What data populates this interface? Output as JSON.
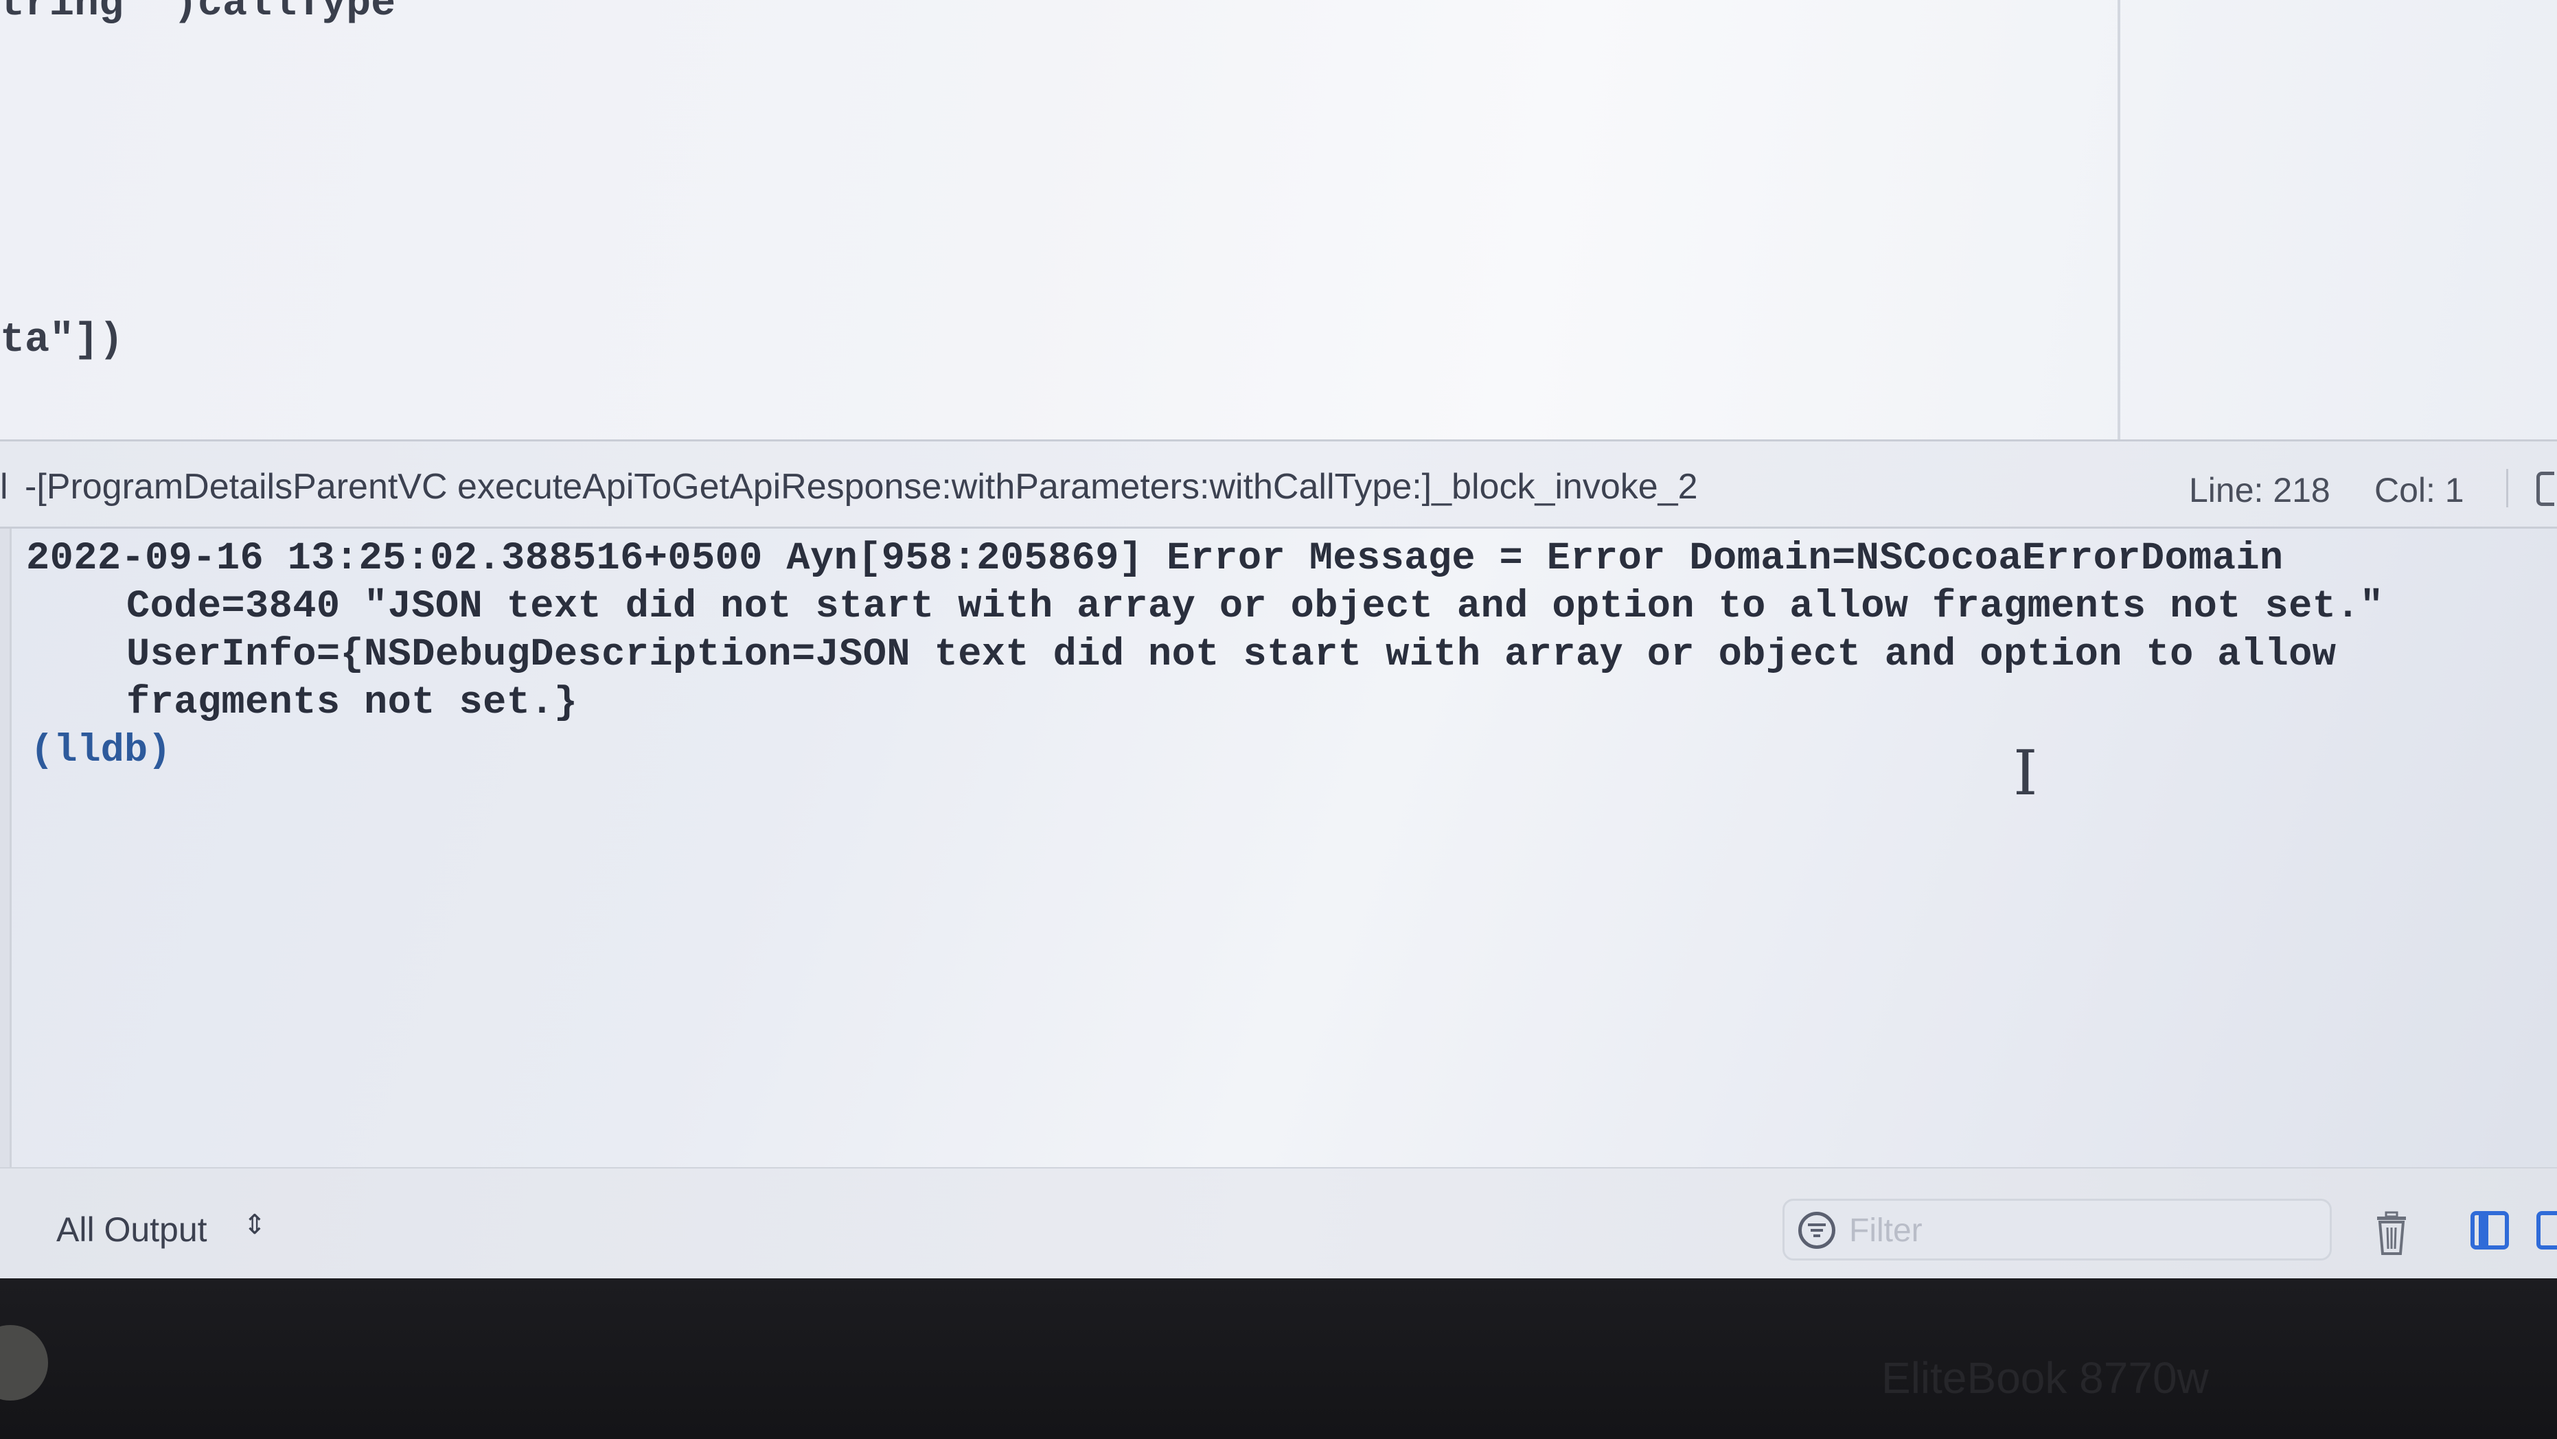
{
  "editor": {
    "code_line_1": "tring *)callType",
    "code_line_2": "ta\"])"
  },
  "debug_bar": {
    "prefix": "l",
    "frame": "-[ProgramDetailsParentVC executeApiToGetApiResponse:withParameters:withCallType:]_block_invoke_2",
    "line_label": "Line: 218",
    "col_label": "Col: 1"
  },
  "console": {
    "lines": [
      "2022-09-16 13:25:02.388516+0500 Ayn[958:205869] Error Message = Error Domain=NSCocoaErrorDomain",
      "Code=3840 \"JSON text did not start with array or object and option to allow fragments not set.\"",
      "UserInfo={NSDebugDescription=JSON text did not start with array or object and option to allow",
      "fragments not set.}"
    ],
    "prompt": "(lldb)",
    "cursor_glyph": "I"
  },
  "bottom_bar": {
    "output_selector": "All Output",
    "filter_placeholder": "Filter"
  },
  "icons": {
    "filter": "filter-icon",
    "trash": "trash-icon",
    "panel_left": "panel-left-icon",
    "panel_right": "panel-right-icon",
    "chevron": "up-down-chevron-icon",
    "text_cursor": "text-cursor-icon"
  },
  "colors": {
    "console_text": "#2a2f3d",
    "lldb_prompt": "#2d5a9c",
    "panel_icon_accent": "#2f6bd8",
    "bezel": "#141417"
  },
  "bezel": {
    "brand_text": "EliteBook 8770w"
  }
}
